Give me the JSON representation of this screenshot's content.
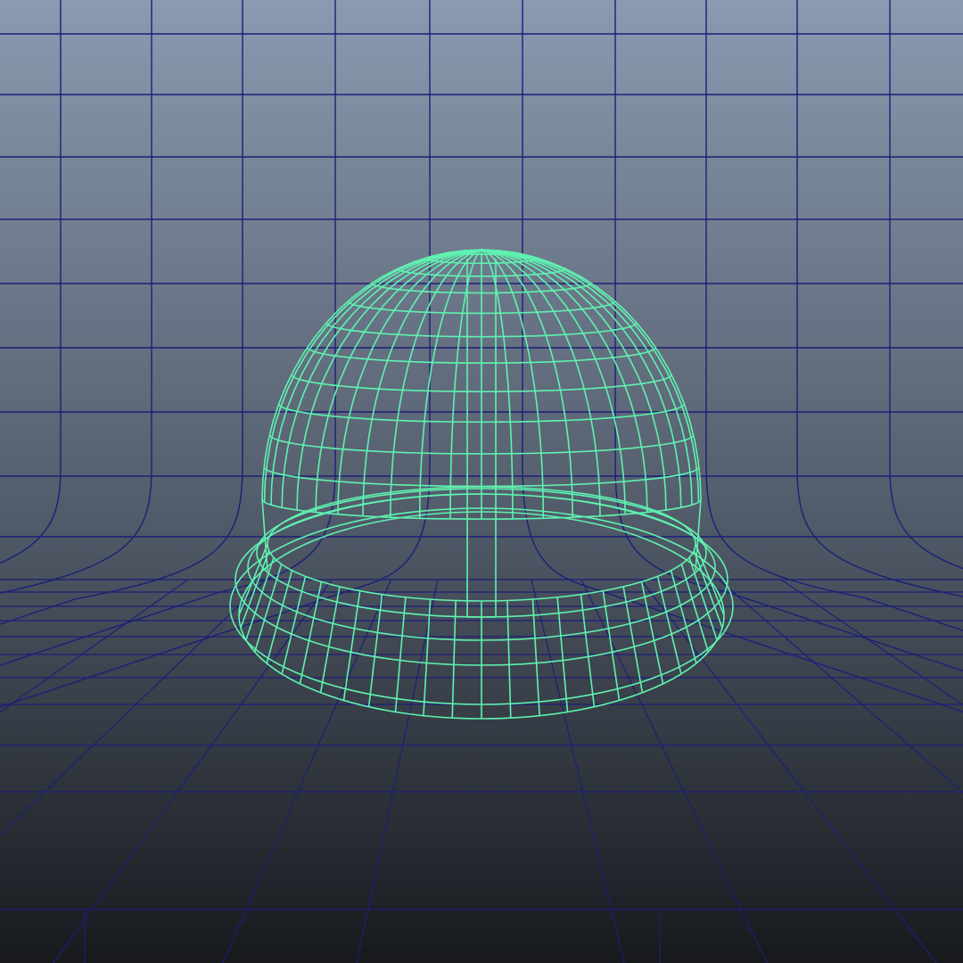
{
  "viewport": {
    "view_mode": "wireframe",
    "colors": {
      "background_top": "#8a9ab0",
      "background_mid": "#56606f",
      "background_bottom": "#17191d",
      "grid_line": "#1c1f78",
      "wireframe": "#5ff2b0"
    },
    "object": {
      "kind": "hard-hat helmet",
      "wireframe_visible": true
    },
    "backdrop_grid": {
      "kind": "curved infinity-cove backdrop"
    }
  }
}
